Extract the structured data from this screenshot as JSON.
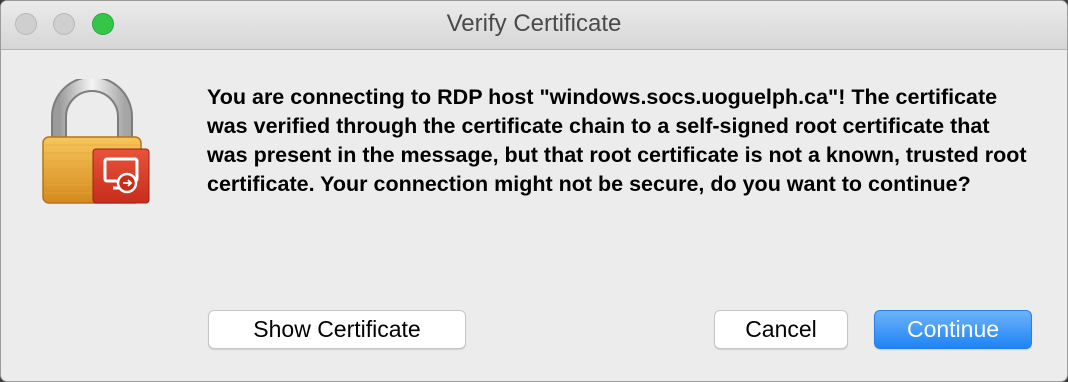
{
  "window": {
    "title": "Verify Certificate",
    "controls": [
      "close-button",
      "minimize-button",
      "zoom-button"
    ]
  },
  "dialog": {
    "icon": "lock-certificate-icon",
    "message": "You are connecting to RDP host \"windows.socs.uoguelph.ca\"! The certificate was verified through the certificate chain to a self-signed root certificate that was present in the message, but that root certificate is not a known, trusted root certificate. Your connection might not be secure, do you want to continue?"
  },
  "buttons": {
    "show_certificate": "Show Certificate",
    "cancel": "Cancel",
    "continue": "Continue"
  },
  "colors": {
    "primary_button": "#1f83f5",
    "zoom_button": "#35c649"
  }
}
